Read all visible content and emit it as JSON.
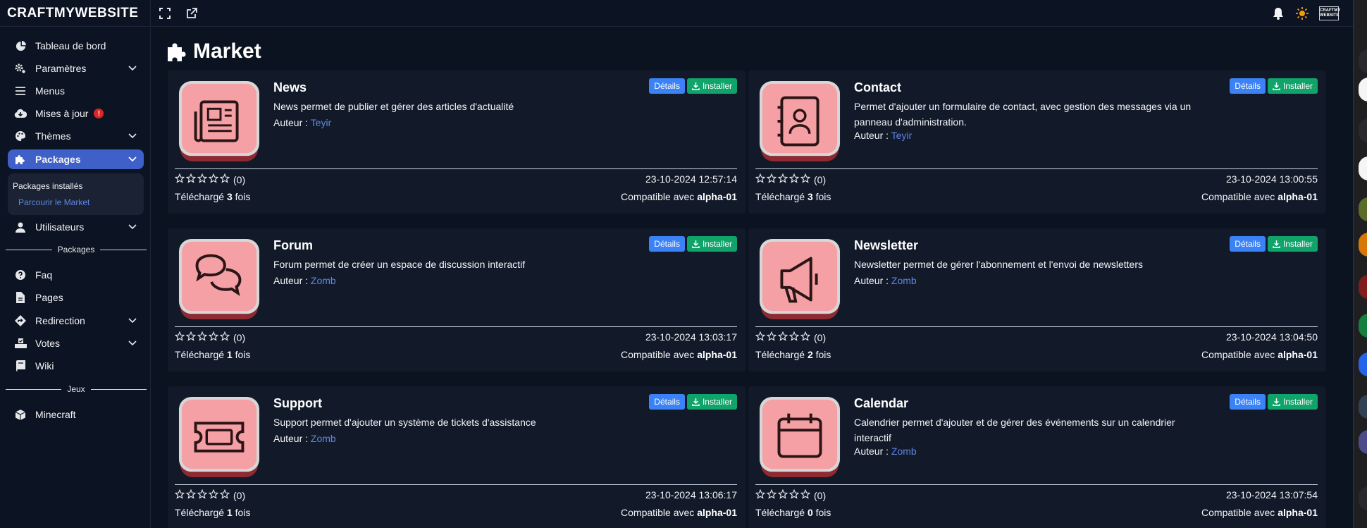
{
  "app": {
    "logo": "CRAFTMYWEBSITE",
    "mini_logo": "CRAFTMY WEBSITE"
  },
  "sidebar": {
    "items": [
      {
        "label": "Tableau de bord",
        "icon": "dashboard-icon"
      },
      {
        "label": "Paramètres",
        "icon": "gears-icon"
      },
      {
        "label": "Menus",
        "icon": "bars-icon"
      },
      {
        "label": "Mises à jour",
        "icon": "cloud-download-icon",
        "badge": "!"
      },
      {
        "label": "Thèmes",
        "icon": "palette-icon"
      },
      {
        "label": "Packages",
        "icon": "puzzle-icon"
      },
      {
        "label": "Utilisateurs",
        "icon": "user-icon"
      },
      {
        "label": "Faq",
        "icon": "question-icon"
      },
      {
        "label": "Pages",
        "icon": "file-icon"
      },
      {
        "label": "Redirection",
        "icon": "directions-icon"
      },
      {
        "label": "Votes",
        "icon": "vote-icon"
      },
      {
        "label": "Wiki",
        "icon": "book-icon"
      },
      {
        "label": "Minecraft",
        "icon": "cube-icon"
      }
    ],
    "submenu": {
      "installed": "Packages installés",
      "browse": "Parcourir le Market"
    },
    "section_packages": "Packages",
    "section_games": "Jeux"
  },
  "main": {
    "title": "Market",
    "labels": {
      "details": "Détails",
      "install": "Installer",
      "author_prefix": "Auteur :",
      "downloaded_prefix": "Téléchargé",
      "downloaded_suffix": "fois",
      "compatible_prefix": "Compatible avec"
    },
    "packages": [
      {
        "name": "News",
        "description": "News permet de publier et gérer des articles d'actualité",
        "author": "Teyir",
        "rating": "(0)",
        "date": "23-10-2024 12:57:14",
        "downloads": "3",
        "compat": "alpha-01"
      },
      {
        "name": "Contact",
        "description": "Permet d'ajouter un formulaire de contact, avec gestion des messages via un panneau d'administration.",
        "author": "Teyir",
        "rating": "(0)",
        "date": "23-10-2024 13:00:55",
        "downloads": "3",
        "compat": "alpha-01"
      },
      {
        "name": "Forum",
        "description": "Forum permet de créer un espace de discussion interactif",
        "author": "Zomb",
        "rating": "(0)",
        "date": "23-10-2024 13:03:17",
        "downloads": "1",
        "compat": "alpha-01"
      },
      {
        "name": "Newsletter",
        "description": "Newsletter permet de gérer l'abonnement et l'envoi de newsletters",
        "author": "Zomb",
        "rating": "(0)",
        "date": "23-10-2024 13:04:50",
        "downloads": "2",
        "compat": "alpha-01"
      },
      {
        "name": "Support",
        "description": "Support permet d'ajouter un système de tickets d'assistance",
        "author": "Zomb",
        "rating": "(0)",
        "date": "23-10-2024 13:06:17",
        "downloads": "1",
        "compat": "alpha-01"
      },
      {
        "name": "Calendar",
        "description": "Calendrier permet d'ajouter et de gérer des événements sur un calendrier interactif",
        "author": "Zomb",
        "rating": "(0)",
        "date": "23-10-2024 13:07:54",
        "downloads": "0",
        "compat": "alpha-01"
      }
    ]
  },
  "colors": {
    "accent": "#3f5fc9",
    "link": "#5f86e6",
    "details_button": "#3b82f6",
    "install_button": "#10a36a",
    "thumb_pink": "#f4a0a4"
  }
}
